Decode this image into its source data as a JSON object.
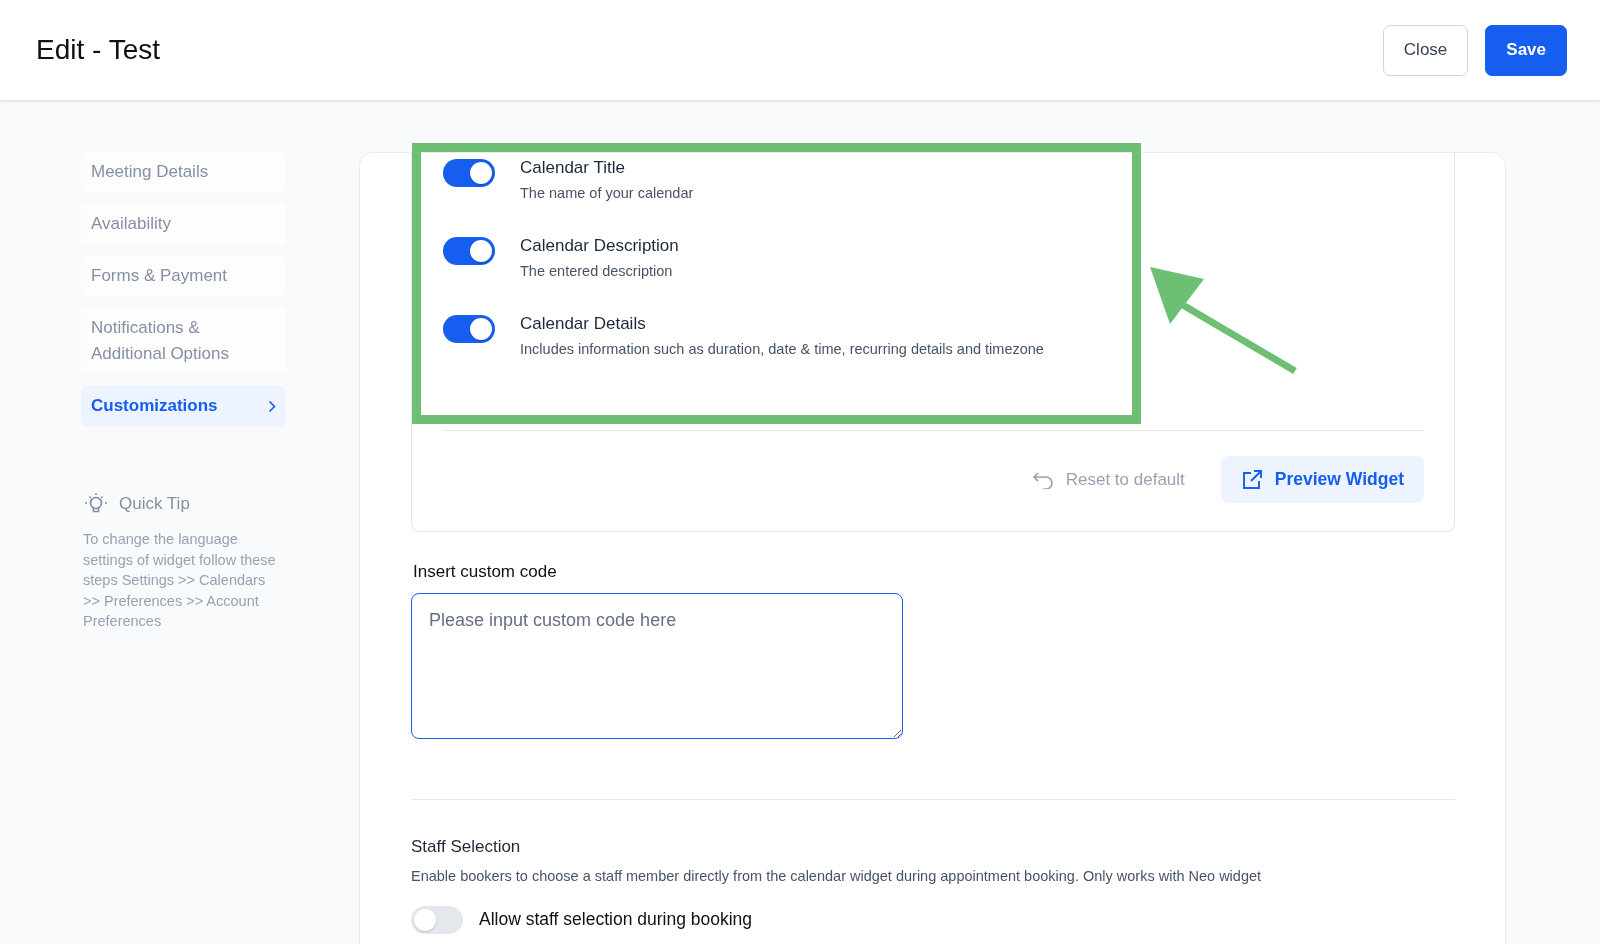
{
  "header": {
    "title": "Edit - Test",
    "buttons": [
      {
        "label": "Close",
        "kind": "secondary"
      },
      {
        "label": "Save",
        "kind": "primary"
      }
    ]
  },
  "sidebar": {
    "items": [
      {
        "label": "Meeting Details",
        "selected": false
      },
      {
        "label": "Availability",
        "selected": false
      },
      {
        "label": "Forms & Payment",
        "selected": false
      },
      {
        "label": "Notifications & Additional Options",
        "selected": false
      },
      {
        "label": "Customizations",
        "selected": true
      }
    ]
  },
  "quick_tip": {
    "title": "Quick Tip",
    "text": "To change the language settings of widget follow these steps Settings >> Calendars >> Preferences >> Account Preferences"
  },
  "display_options": [
    {
      "title": "Calendar Title",
      "description": "The name of your calendar",
      "on": true
    },
    {
      "title": "Calendar Description",
      "description": "The entered description",
      "on": true
    },
    {
      "title": "Calendar Details",
      "description": "Includes information such as duration, date & time, recurring details and timezone",
      "on": true
    }
  ],
  "actions": {
    "reset": "Reset to default",
    "preview": "Preview Widget"
  },
  "custom_code": {
    "label": "Insert custom code",
    "placeholder": "Please input custom code here"
  },
  "staff_selection": {
    "title": "Staff Selection",
    "description": "Enable bookers to choose a staff member directly from the calendar widget during appointment booking. Only works with Neo widget",
    "toggle": {
      "label": "Allow staff selection during booking",
      "on": false
    }
  }
}
